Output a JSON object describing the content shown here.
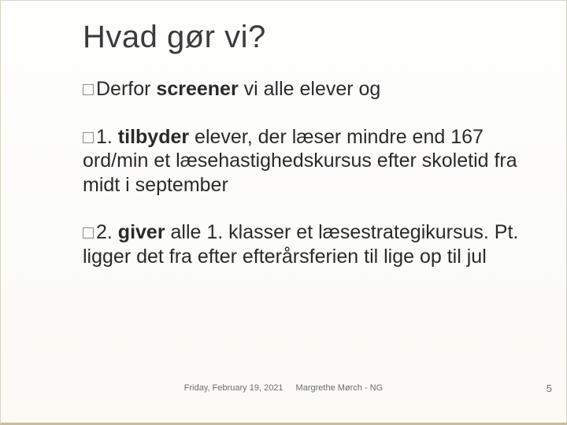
{
  "slide": {
    "title": "Hvad gør vi?",
    "paragraphs": [
      {
        "lead": "Derfor",
        "bold": "screener",
        "rest": " vi alle elever og"
      },
      {
        "lead": "1. ",
        "bold": "tilbyder",
        "rest": " elever, der læser mindre end 167 ord/min et læsehastighedskursus efter skoletid fra midt i september"
      },
      {
        "lead": "2. ",
        "bold": "giver",
        "rest": " alle 1. klasser et læsestrategikursus. Pt. ligger det fra efter efterårsferien til lige op til jul"
      }
    ],
    "footer": {
      "date": "Friday, February 19, 2021",
      "author": "Margrethe Mørch -   NG"
    },
    "page_number": "5"
  }
}
